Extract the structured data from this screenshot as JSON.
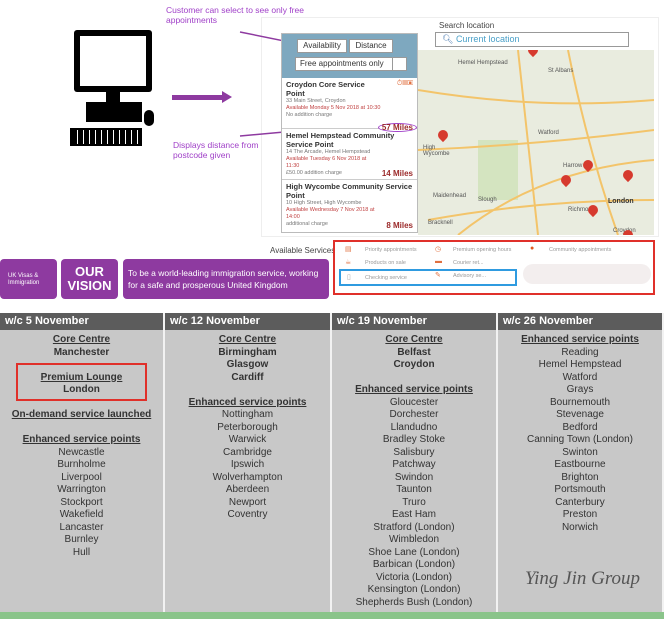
{
  "annotations": {
    "free_note": "Customer can select to see only free appointments",
    "distance_note": "Displays distance from postcode given"
  },
  "filter": {
    "availability": "Availability",
    "distance": "Distance",
    "free_only": "Free appointments only"
  },
  "search": {
    "label": "Search location",
    "placeholder": "Current location"
  },
  "results": [
    {
      "name": "Croydon Core Service Point",
      "address": "33 Main Street, Croydon",
      "available": "Available Monday 5 Nov 2018 at 10:30",
      "charge": "No addition charge",
      "distance": "57 Miles"
    },
    {
      "name": "Hemel Hempstead Community Service Point",
      "address": "14 The Arcade, Hemel Hempstead",
      "available": "Available Tuesday 6 Nov 2018 at 11:30",
      "charge": "£50.00 addition charge",
      "distance": "14 Miles"
    },
    {
      "name": "High Wycombe Community Service Point",
      "address": "10 High Street, High Wycombe",
      "available": "Available Wednesday 7 Nov 2018 at 14:00",
      "charge": "additional charge",
      "distance": "8 Miles"
    }
  ],
  "map_labels": [
    "Hemel Hempstead",
    "St Albans",
    "Watford",
    "High Wycombe",
    "Harrow",
    "London",
    "Slough",
    "Maidenhead",
    "Richmond",
    "Croydon",
    "Bracknell"
  ],
  "services": {
    "title": "Available Services",
    "items": [
      "Priority appointments",
      "Premium opening hours",
      "Community appointments",
      "Products on sale",
      "Courier ret...",
      "Checking service",
      "Advisory se..."
    ]
  },
  "banner": {
    "logo": "UK Visas & Immigration",
    "vision": "OUR VISION",
    "statement": "To be a world-leading immigration service, working for a safe and prosperous United Kingdom"
  },
  "schedule": [
    {
      "week": "w/c 5 November",
      "blocks": [
        {
          "heading": "Core Centre",
          "items": [
            "Manchester"
          ],
          "bold": true
        },
        {
          "heading": "Premium Lounge",
          "items": [
            "London"
          ],
          "bold": true,
          "highlight": true
        },
        {
          "heading": "On-demand service launched",
          "items": []
        },
        {
          "heading": "Enhanced service points",
          "items": [
            "Newcastle",
            "Burnholme",
            "Liverpool",
            "Warrington",
            "Stockport",
            "Wakefield",
            "Lancaster",
            "Burnley",
            "Hull"
          ]
        }
      ]
    },
    {
      "week": "w/c 12 November",
      "blocks": [
        {
          "heading": "Core Centre",
          "items": [
            "Birmingham",
            "Glasgow",
            "Cardiff"
          ],
          "bold": true
        },
        {
          "heading": "Enhanced service points",
          "items": [
            "Nottingham",
            "Peterborough",
            "Warwick",
            "Cambridge",
            "Ipswich",
            "Wolverhampton",
            "Aberdeen",
            "Newport",
            "Coventry"
          ]
        }
      ]
    },
    {
      "week": "w/c 19 November",
      "blocks": [
        {
          "heading": "Core Centre",
          "items": [
            "Belfast",
            "Croydon"
          ],
          "bold": true
        },
        {
          "heading": "Enhanced service points",
          "items": [
            "Gloucester",
            "Dorchester",
            "Llandudno",
            "Bradley Stoke",
            "Salisbury",
            "Patchway",
            "Swindon",
            "Taunton",
            "Truro",
            "East Ham",
            "Stratford (London)",
            "Wimbledon",
            "Shoe Lane (London)",
            "Barbican (London)",
            "Victoria (London)",
            "Kensington (London)",
            "Shepherds Bush (London)"
          ]
        }
      ]
    },
    {
      "week": "w/c 26 November",
      "blocks": [
        {
          "heading": "Enhanced service points",
          "items": [
            "Reading",
            "Hemel Hempstead",
            "Watford",
            "Grays",
            "Bournemouth",
            "Stevenage",
            "Bedford",
            "Canning Town (London)",
            "Swinton",
            "Eastbourne",
            "Brighton",
            "Portsmouth",
            "Canterbury",
            "Preston",
            "Norwich"
          ]
        }
      ]
    }
  ],
  "watermark": "Ying Jin Group",
  "colors": {
    "purple": "#8e3aa0",
    "header": "#5c5c5c",
    "body": "#c8c8c8",
    "red": "#e0302a",
    "blue": "#2f9be0"
  }
}
